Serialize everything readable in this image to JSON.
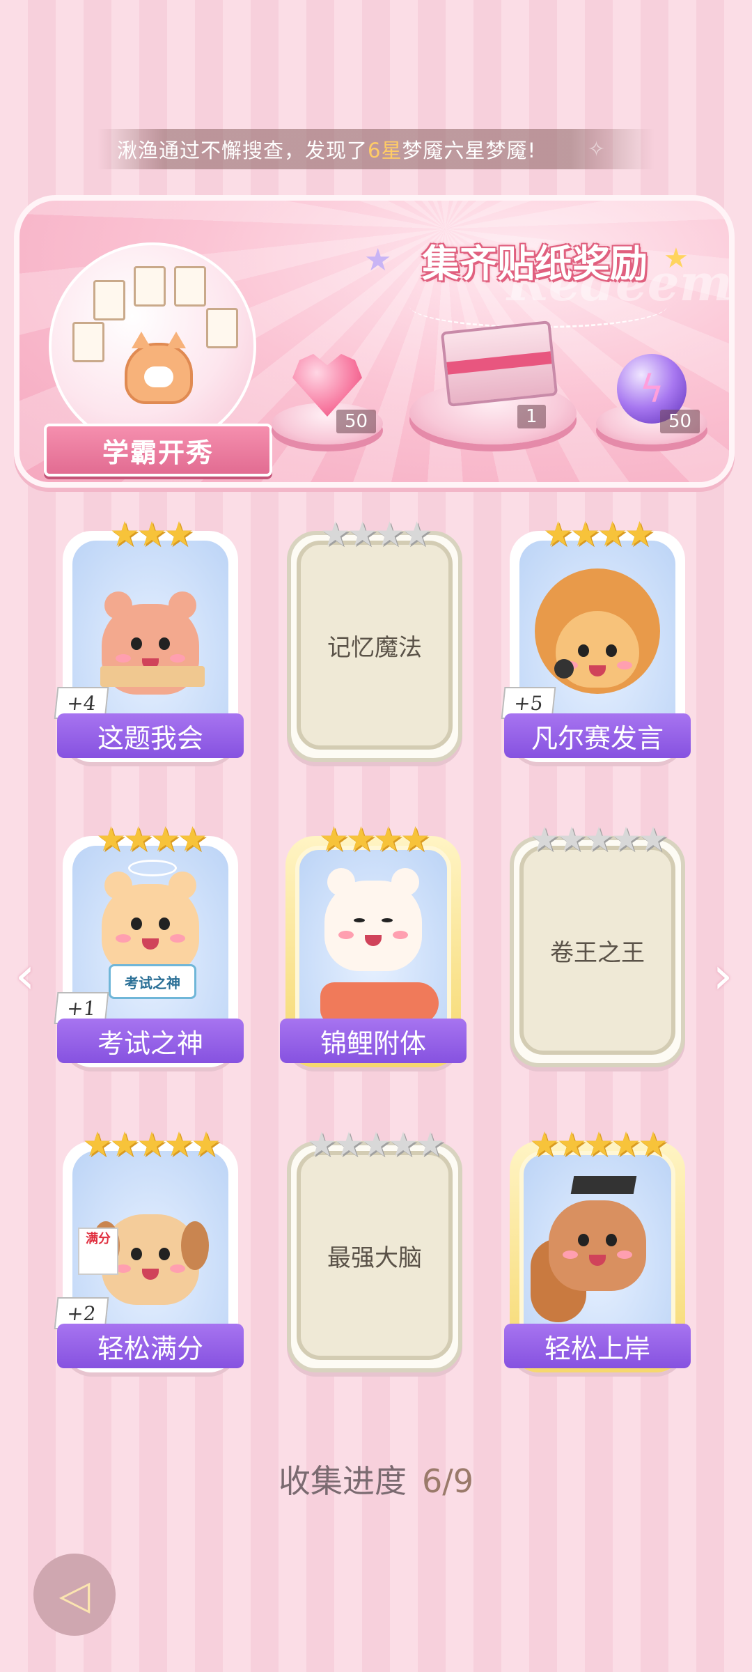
{
  "notice": {
    "prefix": "湫渔通过不懈搜查，发现了",
    "highlight": "6星",
    "suffix": "梦魇六星梦魇!"
  },
  "banner": {
    "title": "集齐贴纸奖励",
    "watermark": "Redeem",
    "plate": "学霸开秀",
    "rewards": [
      {
        "icon": "pink-heart-gem-icon",
        "count": "50"
      },
      {
        "icon": "gift-box-icon",
        "count": "1"
      },
      {
        "icon": "purple-lightning-orb-icon",
        "count": "50"
      }
    ]
  },
  "cards": [
    {
      "name": "这题我会",
      "stars": "★★★",
      "locked": false,
      "plus": "+4",
      "animal": "bear"
    },
    {
      "name": "记忆魔法",
      "stars": "★★★★",
      "locked": true
    },
    {
      "name": "凡尔赛发言",
      "stars": "★★★★",
      "locked": false,
      "plus": "+5",
      "animal": "lion"
    },
    {
      "name": "考试之神",
      "stars": "★★★★",
      "locked": false,
      "plus": "+1",
      "animal": "cat",
      "sign": "考试之神"
    },
    {
      "name": "锦鲤附体",
      "stars": "★★★★",
      "locked": false,
      "gold": true,
      "animal": "polar-bear"
    },
    {
      "name": "卷王之王",
      "stars": "★★★★★",
      "locked": true
    },
    {
      "name": "轻松满分",
      "stars": "★★★★★",
      "locked": false,
      "plus": "+2",
      "animal": "dog",
      "sign": "满分"
    },
    {
      "name": "最强大脑",
      "stars": "★★★★★",
      "locked": true
    },
    {
      "name": "轻松上岸",
      "stars": "★★★★★",
      "locked": false,
      "gold": true,
      "animal": "squirrel"
    }
  ],
  "progress": {
    "label": "收集进度",
    "value": "6/9"
  },
  "colors": {
    "accent_purple": "#8652e0",
    "gold_star": "#f7c33a",
    "pink_bg": "#fbdde6"
  }
}
